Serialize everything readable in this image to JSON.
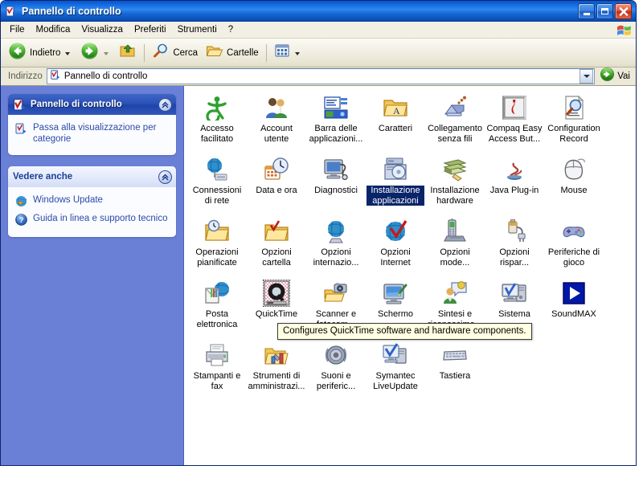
{
  "window": {
    "title": "Pannello di controllo",
    "title_icon": "control-panel-icon",
    "controls": {
      "minimize": "minimize-button",
      "maximize": "maximize-button",
      "close": "close-button"
    }
  },
  "menubar": {
    "items": [
      {
        "label": "File"
      },
      {
        "label": "Modifica"
      },
      {
        "label": "Visualizza"
      },
      {
        "label": "Preferiti"
      },
      {
        "label": "Strumenti"
      },
      {
        "label": "?"
      }
    ],
    "brand_icon": "windows-flag-icon"
  },
  "toolbar": {
    "back_label": "Indietro",
    "back_icon": "back-arrow-icon",
    "forward_icon": "forward-arrow-icon",
    "up_icon": "up-folder-icon",
    "search_label": "Cerca",
    "search_icon": "magnifier-icon",
    "folders_label": "Cartelle",
    "folders_icon": "folder-open-icon",
    "views_icon": "views-grid-icon"
  },
  "address": {
    "label": "Indirizzo",
    "value": "Pannello di controllo",
    "icon": "control-panel-icon",
    "dropdown_icon": "chevron-down-icon",
    "go_label": "Vai",
    "go_icon": "go-arrow-icon"
  },
  "sidebar": {
    "panels": [
      {
        "title": "Pannello di controllo",
        "style": "blue",
        "header_icon": "control-panel-icon",
        "collapse_icon": "chevron-up-icon",
        "links": [
          {
            "label": "Passa alla visualizzazione per categorie",
            "icon": "switch-view-icon"
          }
        ]
      },
      {
        "title": "Vedere anche",
        "style": "light",
        "collapse_icon": "chevron-up-icon",
        "links": [
          {
            "label": "Windows Update",
            "icon": "windows-update-icon"
          },
          {
            "label": "Guida in linea e supporto tecnico",
            "icon": "help-question-icon"
          }
        ]
      }
    ]
  },
  "content": {
    "items": [
      {
        "label": "Accesso facilitato",
        "icon": "accessibility-icon",
        "state": "normal"
      },
      {
        "label": "Account utente",
        "icon": "user-accounts-icon",
        "state": "normal"
      },
      {
        "label": "Barra delle applicazioni...",
        "icon": "taskbar-icon",
        "state": "normal"
      },
      {
        "label": "Caratteri",
        "icon": "fonts-folder-icon",
        "state": "normal"
      },
      {
        "label": "Collegamento senza fili",
        "icon": "wireless-link-icon",
        "state": "normal"
      },
      {
        "label": "Compaq Easy Access But...",
        "icon": "compaq-easy-access-icon",
        "state": "normal"
      },
      {
        "label": "Configuration Record",
        "icon": "configuration-record-icon",
        "state": "normal"
      },
      {
        "label": "Connessioni di rete",
        "icon": "network-connections-icon",
        "state": "normal"
      },
      {
        "label": "Data e ora",
        "icon": "date-time-icon",
        "state": "normal"
      },
      {
        "label": "Diagnostici",
        "icon": "diagnostics-icon",
        "state": "normal"
      },
      {
        "label": "Installazione applicazioni",
        "icon": "add-remove-programs-icon",
        "state": "selected"
      },
      {
        "label": "Installazione hardware",
        "icon": "add-hardware-icon",
        "state": "normal"
      },
      {
        "label": "Java Plug-in",
        "icon": "java-plugin-icon",
        "state": "normal"
      },
      {
        "label": "Mouse",
        "icon": "mouse-icon",
        "state": "normal"
      },
      {
        "label": "Operazioni pianificate",
        "icon": "scheduled-tasks-icon",
        "state": "normal"
      },
      {
        "label": "Opzioni cartella",
        "icon": "folder-options-icon",
        "state": "normal"
      },
      {
        "label": "Opzioni internazio...",
        "icon": "regional-options-icon",
        "state": "normal"
      },
      {
        "label": "Opzioni Internet",
        "icon": "internet-options-icon",
        "state": "normal"
      },
      {
        "label": "Opzioni mode...",
        "icon": "phone-modem-options-icon",
        "state": "normal"
      },
      {
        "label": "Opzioni rispar...",
        "icon": "power-options-icon",
        "state": "normal"
      },
      {
        "label": "Periferiche di gioco",
        "icon": "game-controllers-icon",
        "state": "normal"
      },
      {
        "label": "Posta elettronica",
        "icon": "mail-icon",
        "state": "normal"
      },
      {
        "label": "QuickTime",
        "icon": "quicktime-icon",
        "state": "hovered"
      },
      {
        "label": "Scanner e fotocam...",
        "icon": "scanners-cameras-icon",
        "state": "normal"
      },
      {
        "label": "Schermo",
        "icon": "display-icon",
        "state": "normal"
      },
      {
        "label": "Sintesi e riconoscime...",
        "icon": "speech-icon",
        "state": "normal"
      },
      {
        "label": "Sistema",
        "icon": "system-icon",
        "state": "normal"
      },
      {
        "label": "SoundMAX",
        "icon": "soundmax-icon",
        "state": "normal"
      },
      {
        "label": "Stampanti e fax",
        "icon": "printers-faxes-icon",
        "state": "normal"
      },
      {
        "label": "Strumenti di amministrazi...",
        "icon": "administrative-tools-icon",
        "state": "normal"
      },
      {
        "label": "Suoni e periferic...",
        "icon": "sounds-audio-icon",
        "state": "normal"
      },
      {
        "label": "Symantec LiveUpdate",
        "icon": "symantec-liveupdate-icon",
        "state": "normal"
      },
      {
        "label": "Tastiera",
        "icon": "keyboard-icon",
        "state": "normal"
      }
    ]
  },
  "tooltip": {
    "text": "Configures QuickTime software and hardware components."
  },
  "colors": {
    "titlebar_blue": "#0a5ed8",
    "sidebar_blue": "#6a7fd6",
    "selection_blue": "#0a246a",
    "tooltip_bg": "#ffffe1",
    "toolbar_beige": "#ece9d8"
  }
}
